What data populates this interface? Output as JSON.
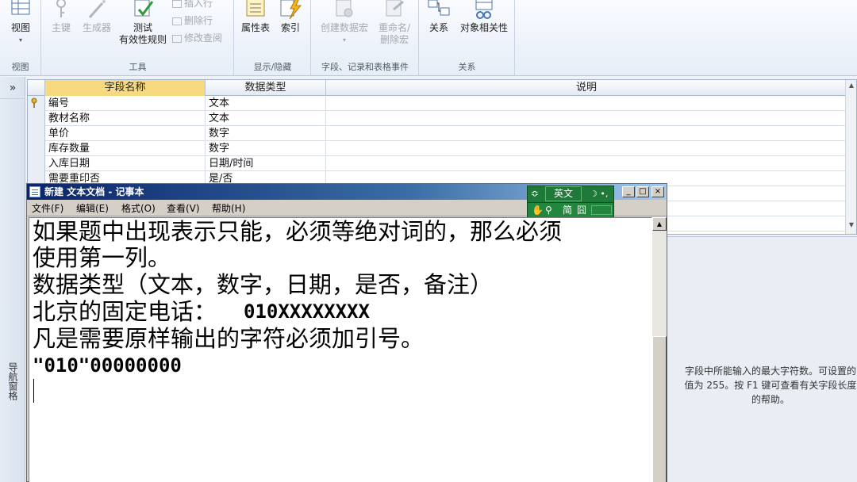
{
  "ribbon": {
    "groups": {
      "view": {
        "caption": "视图",
        "view_button": "视图"
      },
      "tools": {
        "caption": "工具",
        "primary_key": "主键",
        "builder": "生成器",
        "test_validation_line1": "测试",
        "test_validation_line2": "有效性规则",
        "insert_row": "插入行",
        "delete_row": "删除行",
        "modify_lookup": "修改查阅"
      },
      "show_hide": {
        "caption": "显示/隐藏",
        "property_sheet": "属性表",
        "indexes": "索引"
      },
      "events": {
        "caption": "字段、记录和表格事件",
        "create_macro": "创建数据宏",
        "rename_delete_line1": "重命名/",
        "rename_delete_line2": "删除宏"
      },
      "relationships": {
        "caption": "关系",
        "relationships": "关系",
        "object_dependencies": "对象相关性"
      }
    }
  },
  "nav": {
    "expand": "»",
    "label": "导航窗格"
  },
  "grid": {
    "headers": [
      "字段名称",
      "数据类型",
      "说明"
    ],
    "rows": [
      {
        "name": "编号",
        "type": "文本",
        "key": true
      },
      {
        "name": "教材名称",
        "type": "文本",
        "key": false
      },
      {
        "name": "单价",
        "type": "数字",
        "key": false
      },
      {
        "name": "库存数量",
        "type": "数字",
        "key": false
      },
      {
        "name": "入库日期",
        "type": "日期/时间",
        "key": false
      },
      {
        "name": "需要重印否",
        "type": "是/否",
        "key": false
      }
    ]
  },
  "props": {
    "help_line1": "字段中所能输入的最大字符数。可设置的",
    "help_line2": "值为 255。按 F1 键可查看有关字段长度",
    "help_line3": "的帮助。"
  },
  "notepad": {
    "title": "新建 文本文档 - 记事本",
    "menu": [
      "文件(F)",
      "编辑(E)",
      "格式(O)",
      "查看(V)",
      "帮助(H)"
    ],
    "lines": [
      "如果题中出现表示只能，必须等绝对词的，那么必须",
      "使用第一列。",
      "数据类型（文本，数字，日期，是否，备注）",
      "北京的固定电话：",
      "010XXXXXXXX",
      "凡是需要原样输出的字符必须加引号。",
      "\"010\"00000000"
    ],
    "buttons": {
      "minimize": "_",
      "maximize": "□",
      "close": "×"
    }
  },
  "ime": {
    "mode": "英文",
    "script": "简",
    "width": "囧",
    "arrow": "≎"
  },
  "colors": {
    "title_gradient_start": "#0a246a",
    "ime_green": "#1f7a3a",
    "ribbon_bg": "#e6edf7"
  }
}
